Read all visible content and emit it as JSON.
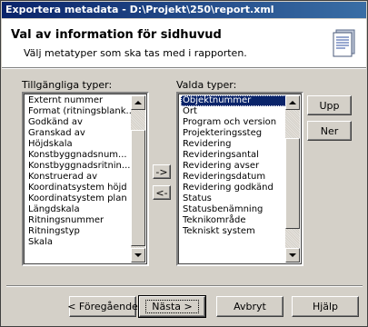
{
  "window": {
    "title": "Exportera metadata - D:\\Projekt\\250\\report.xml"
  },
  "header": {
    "title": "Val av information för sidhuvud",
    "subtitle": "Välj metatyper som ska tas med i rapporten.",
    "icon": "document-icon"
  },
  "available": {
    "label": "Tillgängliga typer:",
    "items": [
      "Externt nummer",
      "Format (ritningsblank...",
      "Godkänd av",
      "Granskad av",
      "Höjdskala",
      "Konstbyggnadsnum...",
      "Konstbyggnadsritnin...",
      "Konstruerad av",
      "Koordinatsystem höjd",
      "Koordinatsystem plan",
      "Längdskala",
      "Ritningsnummer",
      "Ritningstyp",
      "Skala"
    ],
    "scroll_position": 0.8
  },
  "selected": {
    "label": "Valda typer:",
    "items": [
      "Objektnummer",
      "Ort",
      "Program och version",
      "Projekteringssteg",
      "Revidering",
      "Revideringsantal",
      "Revidering avser",
      "Revideringsdatum",
      "Revidering godkänd",
      "Status",
      "Statusbenämning",
      "Teknikområde",
      "Tekniskt system"
    ],
    "selected_item": "Objektnummer",
    "scroll_position": 0.55
  },
  "transfer": {
    "add_label": "->",
    "remove_label": "<-"
  },
  "order": {
    "up_label": "Upp",
    "down_label": "Ner"
  },
  "footer": {
    "back_label": "< Föregående",
    "next_label": "Nästa >",
    "cancel_label": "Avbryt",
    "help_label": "Hjälp"
  },
  "colors": {
    "titlebar": "#0a246a",
    "selection": "#0a246a",
    "face": "#d4d0c8"
  }
}
